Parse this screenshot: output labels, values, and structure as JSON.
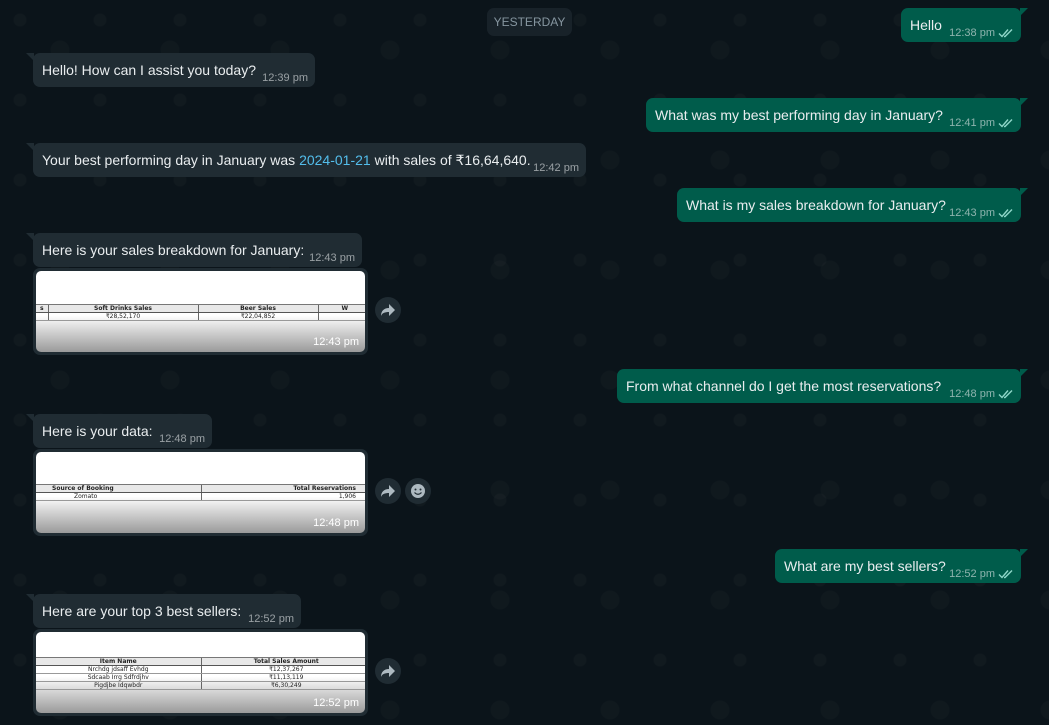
{
  "date_divider": "YESTERDAY",
  "messages": [
    {
      "text": "Hello",
      "time": "12:38 pm"
    },
    {
      "text": "Hello! How can I assist you today?",
      "time": "12:39 pm"
    },
    {
      "text": "What was my best performing day in January?",
      "time": "12:41 pm"
    },
    {
      "text_before": "Your best performing day in January was ",
      "link": "2024-01-21",
      "text_after": " with sales of ₹16,64,640.",
      "time": "12:42 pm"
    },
    {
      "text": "What is my sales breakdown for January?",
      "time": "12:43 pm"
    },
    {
      "text": "Here is your sales breakdown for January:",
      "time": "12:43 pm"
    },
    {
      "text": "From what channel do I get the most reservations?",
      "time": "12:48 pm"
    },
    {
      "text": "Here is your data:",
      "time": "12:48 pm"
    },
    {
      "text": "What are my best sellers?",
      "time": "12:52 pm"
    },
    {
      "text": "Here are your top 3 best sellers:",
      "time": "12:52 pm"
    }
  ],
  "images": [
    {
      "time": "12:43 pm",
      "headers": [
        "s",
        "Soft Drinks Sales",
        "Beer Sales",
        "W"
      ],
      "rows": [
        [
          "",
          "₹28,52,170",
          "₹22,04,852",
          ""
        ]
      ]
    },
    {
      "time": "12:48 pm",
      "headers": [
        "Source of Booking",
        "Total Reservations"
      ],
      "rows": [
        [
          "Zomato",
          "1,906"
        ]
      ]
    },
    {
      "time": "12:52 pm",
      "headers": [
        "Item Name",
        "Total Sales Amount"
      ],
      "rows": [
        [
          "Nrchdg jdsaff Evhdg",
          "₹12,37,267"
        ],
        [
          "Sdcaab Irrg Sdfrdjhv",
          "₹11,13,119"
        ],
        [
          "Pigdjbe Idqwbdr",
          "₹6,30,249"
        ]
      ]
    }
  ],
  "colors": {
    "background": "#0b141a",
    "outgoing_bubble": "#005c4b",
    "incoming_bubble": "#202c33",
    "link": "#53bdeb",
    "read_ticks": "#8ed6c8"
  },
  "icons": [
    "double-check-icon",
    "forward-icon",
    "emoji-icon"
  ]
}
